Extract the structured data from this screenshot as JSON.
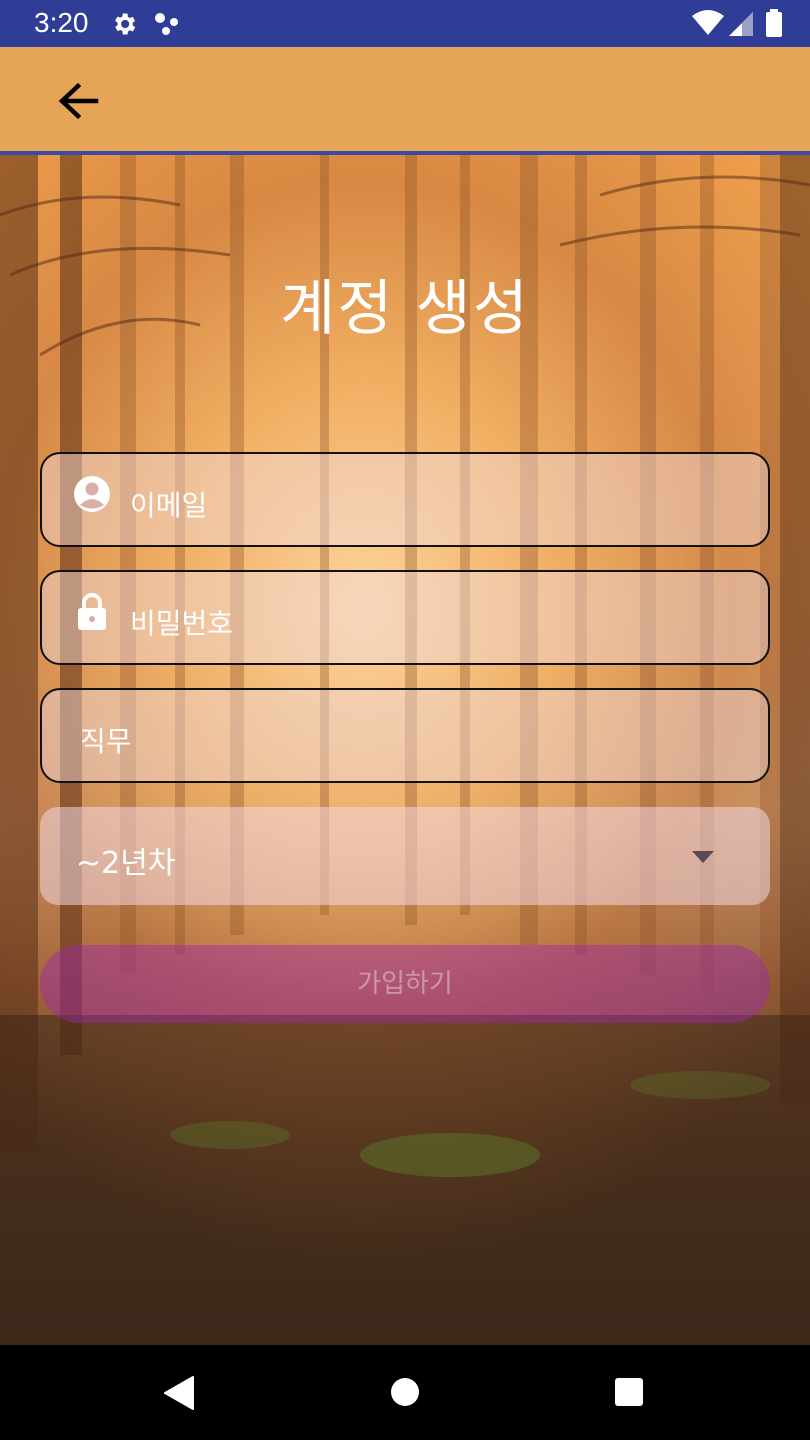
{
  "status_bar": {
    "time": "3:20",
    "icons": [
      "gear-icon",
      "dots-icon",
      "wifi-icon",
      "signal-icon",
      "battery-icon"
    ]
  },
  "app_bar": {
    "back_icon": "arrow-left-icon",
    "background": "#e6a457"
  },
  "main": {
    "title": "계정 생성",
    "email_field": {
      "placeholder": "이메일",
      "icon": "account-circle-icon"
    },
    "password_field": {
      "placeholder": "비밀번호",
      "icon": "lock-icon"
    },
    "job_field": {
      "placeholder": "직무"
    },
    "experience_dropdown": {
      "selected": "~2년차",
      "icon": "caret-down-icon"
    },
    "signup_button": {
      "label": "가입하기"
    }
  },
  "nav_bar": {
    "icons": [
      "back-triangle-icon",
      "home-circle-icon",
      "recents-square-icon"
    ]
  },
  "colors": {
    "status_bar": "#2f3d97",
    "app_bar": "#e6a457",
    "button": "#a028aa"
  }
}
